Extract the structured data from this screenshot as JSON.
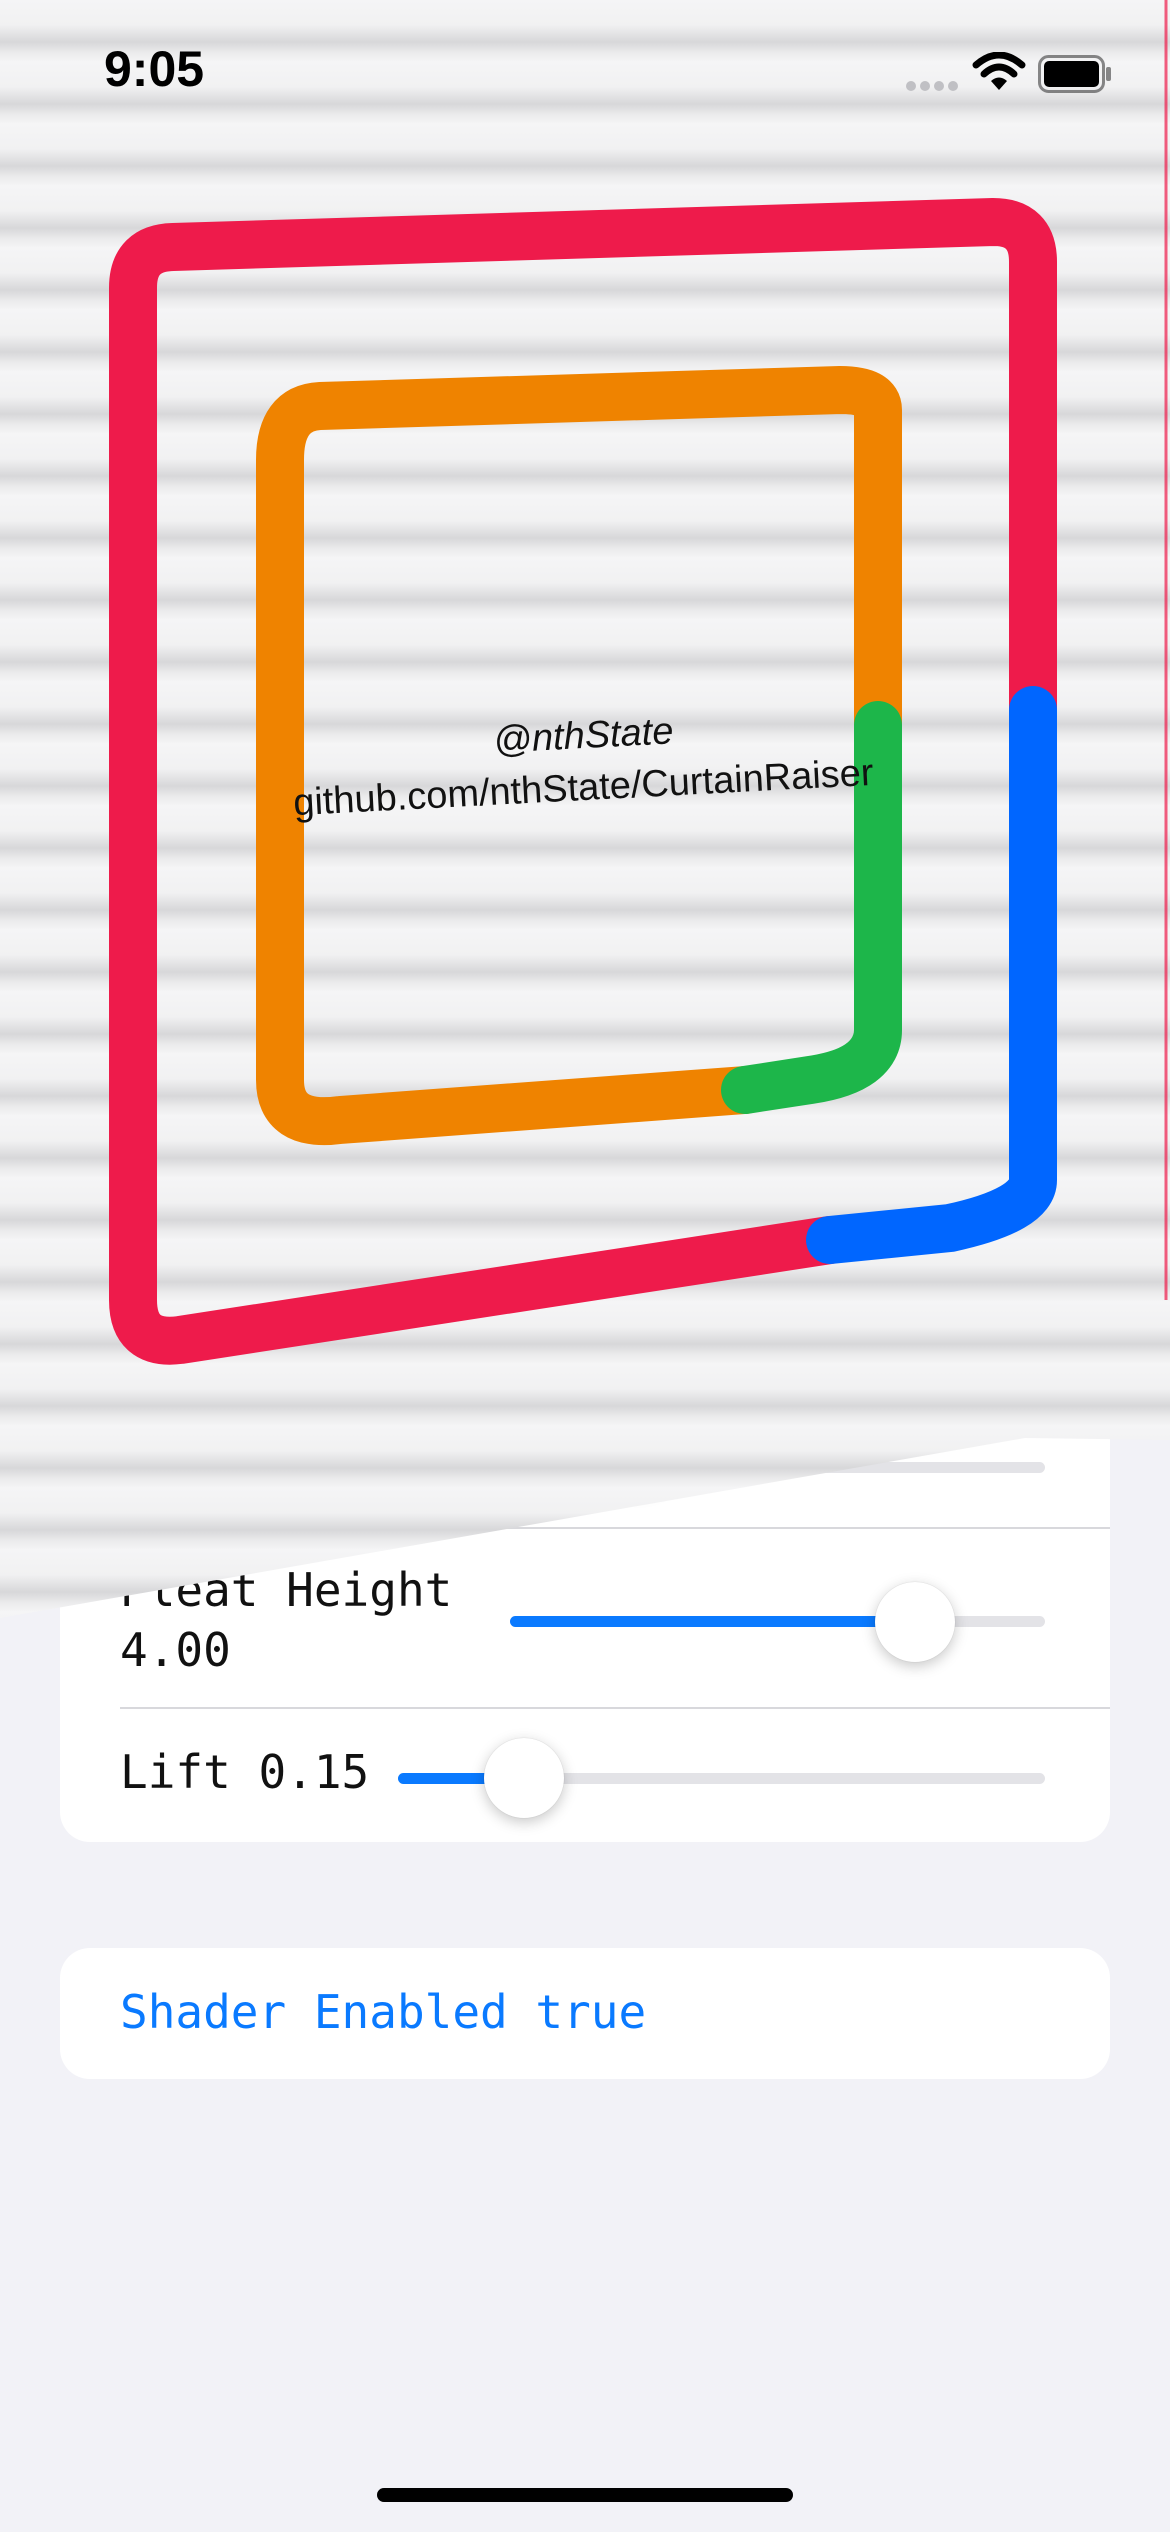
{
  "status_bar": {
    "time": "9:05",
    "icons": [
      "cellular-dots-icon",
      "wifi-icon",
      "battery-icon"
    ]
  },
  "curtain": {
    "handle": "@nthState",
    "url": "github.com/nthState/CurtainRaiser",
    "colors": {
      "outer": "#ee1b4b",
      "inner": "#ef8300",
      "green": "#1db64a",
      "blue": "#0066ff"
    }
  },
  "settings": {
    "partial_row": {
      "value_fraction": 0.18
    },
    "pleat_height": {
      "label": "Pleat Height",
      "value": "4.00",
      "fraction": 0.75
    },
    "lift": {
      "label": "Lift 0.15",
      "value": 0.15
    }
  },
  "shader": {
    "label": "Shader Enabled true"
  },
  "colors": {
    "accent": "#0a7aff",
    "background": "#f2f2f7"
  }
}
